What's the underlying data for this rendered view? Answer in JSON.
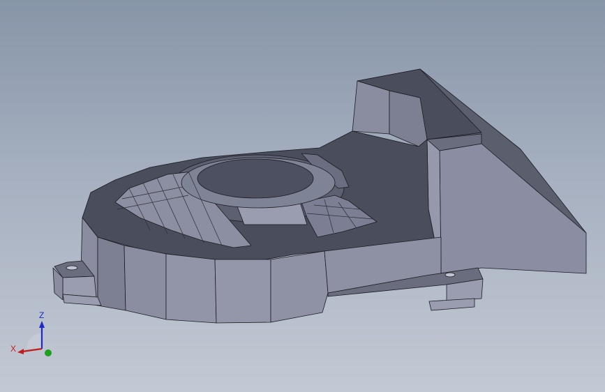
{
  "viewport": {
    "background_top": "#8795a8",
    "background_bottom": "#c3c9d4"
  },
  "model": {
    "face_dark": "#4a4d5c",
    "face_mid": "#5b5e6d",
    "face_light": "#878b9e",
    "face_lighter": "#9a9db0",
    "edge": "#1a1a22"
  },
  "triad": {
    "x_label": "X",
    "z_label": "Z",
    "x_color": "#c01c1c",
    "y_color": "#1ea01e",
    "z_color": "#1c28c8"
  }
}
